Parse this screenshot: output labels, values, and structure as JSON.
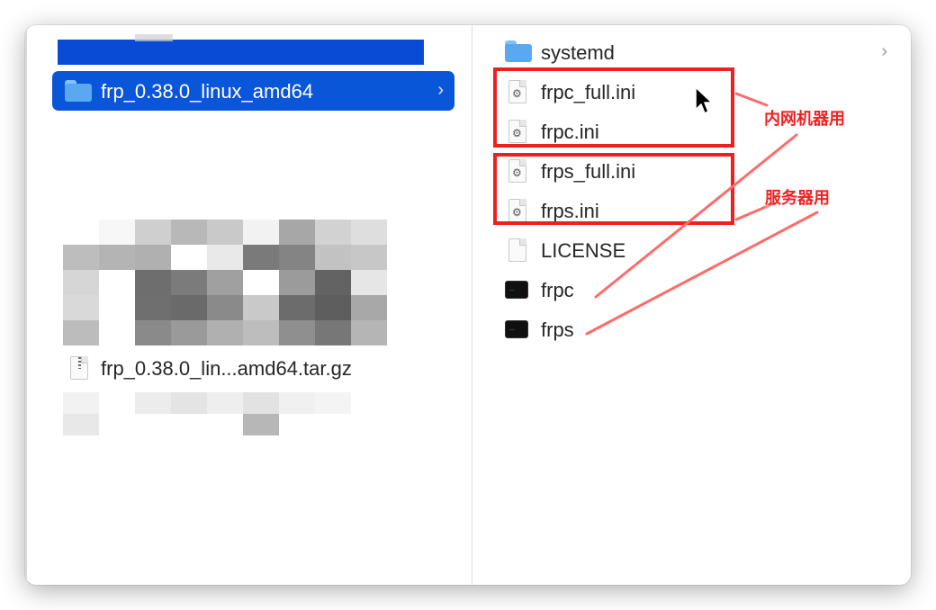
{
  "window": {
    "left_column": {
      "selected_item": {
        "label": "frp_0.38.0_linux_amd64",
        "icon": "folder-icon"
      },
      "file_item": {
        "label": "frp_0.38.0_lin...amd64.tar.gz",
        "icon": "archive-icon"
      }
    },
    "right_column": {
      "items": [
        {
          "label": "systemd",
          "icon": "folder-icon",
          "has_chevron": true
        },
        {
          "label": "frpc_full.ini",
          "icon": "config-file-icon"
        },
        {
          "label": "frpc.ini",
          "icon": "config-file-icon"
        },
        {
          "label": "frps_full.ini",
          "icon": "config-file-icon"
        },
        {
          "label": "frps.ini",
          "icon": "config-file-icon"
        },
        {
          "label": "LICENSE",
          "icon": "document-icon"
        },
        {
          "label": "frpc",
          "icon": "terminal-executable-icon"
        },
        {
          "label": "frps",
          "icon": "terminal-executable-icon"
        }
      ]
    }
  },
  "annotations": {
    "client_label": "内网机器用",
    "server_label": "服务器用"
  },
  "colors": {
    "selection": "#0a56d8",
    "folder": "#5aa8f0",
    "annotation_red": "#ef1f1f",
    "annotation_line": "#ff6b6b"
  }
}
